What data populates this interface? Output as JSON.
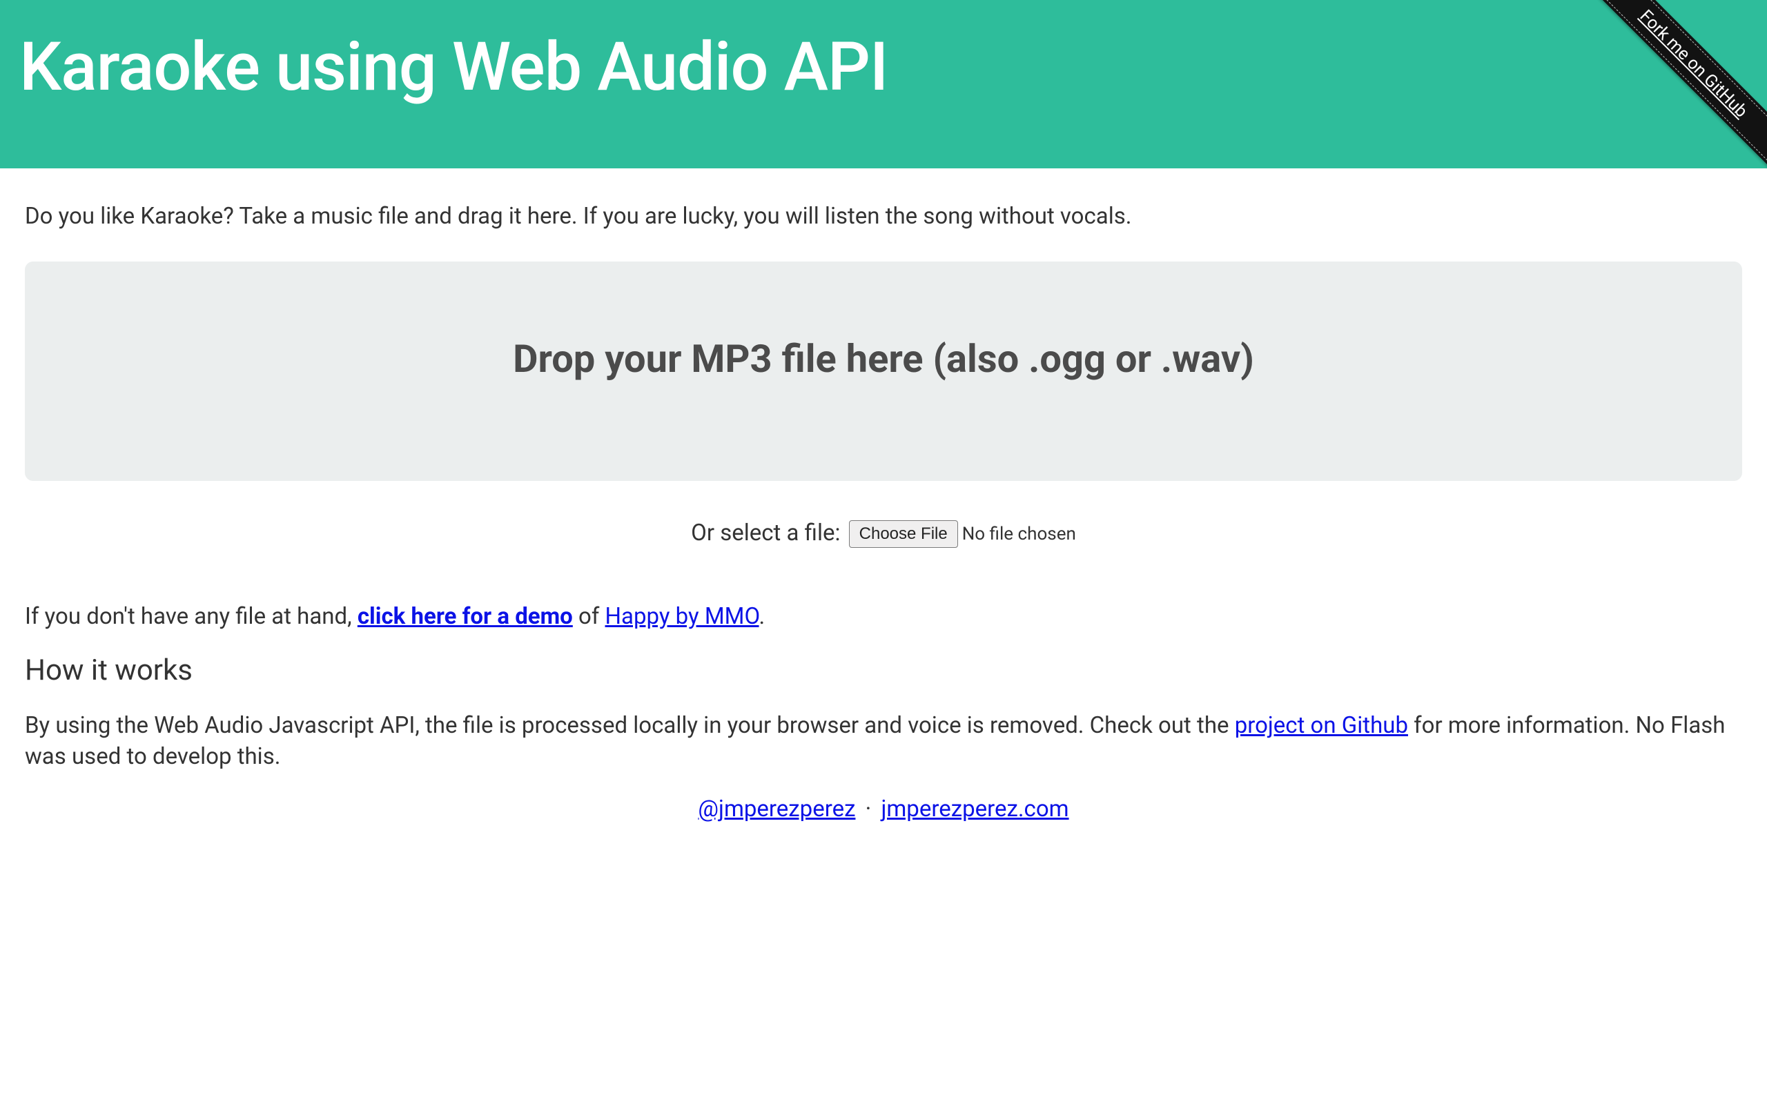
{
  "header": {
    "title": "Karaoke using Web Audio API"
  },
  "ribbon": {
    "label": "Fork me on GitHub"
  },
  "intro": "Do you like Karaoke? Take a music file and drag it here. If you are lucky, you will listen the song without vocals.",
  "dropzone": {
    "title": "Drop your MP3 file here (also .ogg or .wav)"
  },
  "filepicker": {
    "label": "Or select a file: ",
    "button": "Choose File",
    "status": "No file chosen"
  },
  "demo": {
    "prefix": "If you don't have any file at hand, ",
    "demo_link": "click here for a demo",
    "middle": " of ",
    "song_link": "Happy by MMO",
    "suffix": "."
  },
  "how": {
    "heading": "How it works",
    "p1a": "By using the Web Audio Javascript API, the file is processed locally in your browser and voice is removed. Check out the ",
    "link": "project on Github",
    "p1b": " for more information. No Flash was used to develop this."
  },
  "footer": {
    "twitter": "@jmperezperez",
    "sep": " · ",
    "site": "jmperezperez.com"
  }
}
